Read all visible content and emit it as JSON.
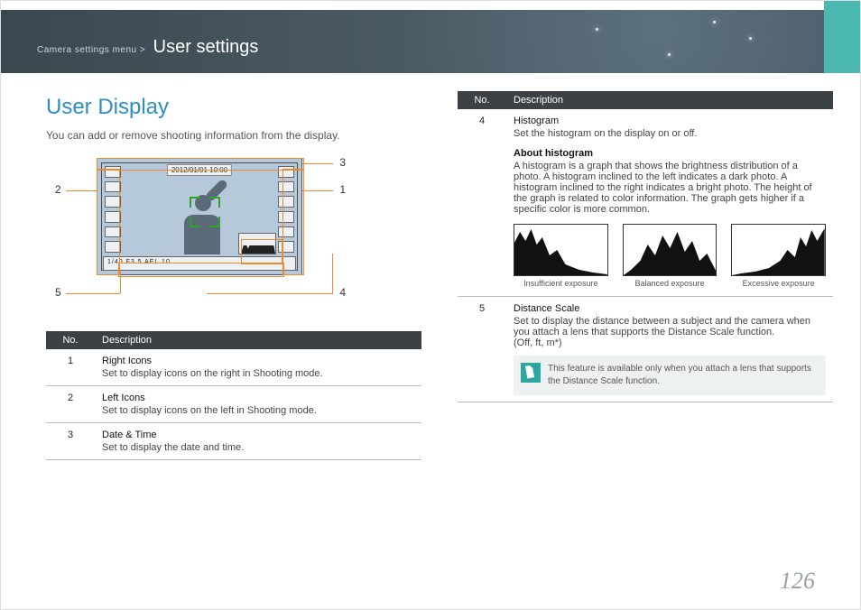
{
  "breadcrumb": {
    "prefix": "Camera settings menu >",
    "title": "User settings"
  },
  "section_title": "User Display",
  "intro": "You can add or remove shooting information from the display.",
  "lcd": {
    "datetime": "2012/01/01 10:00",
    "bottom_strip": "1/40  F3.5          AEL  10"
  },
  "callouts": {
    "n1": "1",
    "n2": "2",
    "n3": "3",
    "n4": "4",
    "n5": "5"
  },
  "table_left": {
    "head_no": "No.",
    "head_desc": "Description",
    "rows": [
      {
        "no": "1",
        "title": "Right Icons",
        "desc": "Set to display icons on the right in Shooting mode."
      },
      {
        "no": "2",
        "title": "Left Icons",
        "desc": "Set to display icons on the left in Shooting mode."
      },
      {
        "no": "3",
        "title": "Date & Time",
        "desc": "Set to display the date and time."
      }
    ]
  },
  "table_right": {
    "head_no": "No.",
    "head_desc": "Description",
    "row4": {
      "no": "4",
      "title": "Histogram",
      "line1": "Set the histogram on the display on or off.",
      "sub_title": "About histogram",
      "sub_body": "A histogram is a graph that shows the brightness distribution of a photo. A histogram inclined to the left indicates a dark photo. A histogram inclined to the right indicates a bright photo. The height of the graph is related to color information. The graph gets higher if a specific color is more common.",
      "hist_labels": [
        "Insufficient exposure",
        "Balanced exposure",
        "Excessive exposure"
      ]
    },
    "row5": {
      "no": "5",
      "title": "Distance Scale",
      "desc": "Set to display the distance between a subject and the camera when you attach a lens that supports the Distance Scale function.",
      "options": "(Off, ft, m*)",
      "note": "This feature is available only when you attach a lens that supports the Distance Scale function."
    }
  },
  "page_number": "126"
}
